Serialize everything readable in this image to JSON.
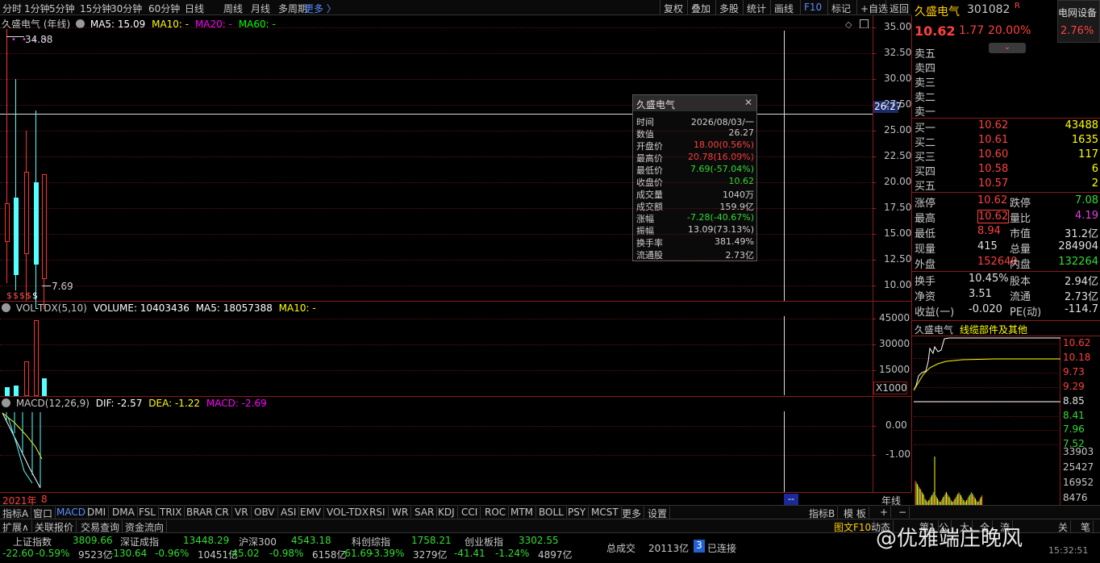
{
  "period_tabs": [
    "分时",
    "1分钟",
    "5分钟",
    "15分钟",
    "30分钟",
    "60分钟",
    "日线",
    "周线",
    "月线",
    "多周期",
    "更多 〉"
  ],
  "right_buttons": [
    "复权",
    "叠加",
    "多股",
    "统计",
    "画线",
    "F10",
    "标记",
    "+自选",
    "返回"
  ],
  "kline": {
    "stock_name_period": "久盛电气 (年线)",
    "ma5": "MA5: 15.09",
    "ma10": "MA10: -",
    "ma20": "MA20: -",
    "ma60": "MA60: -",
    "high_label": "34.88",
    "low_label": "7.69",
    "price_axis": [
      "35.00",
      "32.50",
      "30.00",
      "27.50",
      "25.00",
      "22.50",
      "20.00",
      "17.50",
      "15.00",
      "12.50",
      "10.00"
    ],
    "cursor_price": "26.27",
    "candles": [
      {
        "open": 14.2,
        "close": 18.0,
        "high": 34.88,
        "low": 10.2
      },
      {
        "open": 18.5,
        "close": 11.0,
        "high": 30.0,
        "low": 9.5
      },
      {
        "open": 13.0,
        "close": 21.0,
        "high": 25.0,
        "low": 8.5
      },
      {
        "open": 20.0,
        "close": 12.0,
        "high": 27.0,
        "low": 7.69
      },
      {
        "open": 10.62,
        "close": 20.78,
        "high": 20.78,
        "low": 7.69
      }
    ]
  },
  "tooltip": {
    "title": "久盛电气",
    "close_icon": "close-icon",
    "rows": [
      {
        "k": "时间",
        "v": "2026/08/03/一",
        "c": "#d0d0d0"
      },
      {
        "k": "数值",
        "v": "26.27",
        "c": "#d0d0d0"
      },
      {
        "k": "开盘价",
        "v": "18.00(0.56%)",
        "c": "#ff4040"
      },
      {
        "k": "最高价",
        "v": "20.78(16.09%)",
        "c": "#ff4040"
      },
      {
        "k": "最低价",
        "v": "7.69(-57.04%)",
        "c": "#33dd33"
      },
      {
        "k": "收盘价",
        "v": "10.62",
        "c": "#33dd33"
      },
      {
        "k": "成交量",
        "v": "1040万",
        "c": "#d0d0d0"
      },
      {
        "k": "成交额",
        "v": "159.9亿",
        "c": "#d0d0d0"
      },
      {
        "k": "涨幅",
        "v": "-7.28(-40.67%)",
        "c": "#33dd33"
      },
      {
        "k": "振幅",
        "v": "13.09(73.13%)",
        "c": "#d0d0d0"
      },
      {
        "k": "换手率",
        "v": "381.49%",
        "c": "#d0d0d0"
      },
      {
        "k": "流通股",
        "v": "2.73亿",
        "c": "#d0d0d0"
      }
    ]
  },
  "volume": {
    "legend_name": "VOL-TDX(5,10)",
    "legend_volume": "VOLUME: 10403436",
    "legend_ma5": "MA5: 18057388",
    "legend_ma10": "MA10: -",
    "axis": [
      "45000",
      "30000",
      "15000"
    ],
    "unit": "X1000",
    "bars": [
      {
        "v": 5000,
        "up": false
      },
      {
        "v": 6000,
        "up": false
      },
      {
        "v": 20000,
        "up": true
      },
      {
        "v": 44000,
        "up": true
      },
      {
        "v": 10400,
        "up": false
      }
    ]
  },
  "macd": {
    "legend_name": "MACD(12,26,9)",
    "dif": "DIF: -2.57",
    "dea": "DEA: -1.22",
    "macd": "MACD: -2.69",
    "axis": [
      "0.00",
      "-1.00"
    ]
  },
  "x_axis": {
    "year_label": "2021年",
    "month_label": "8",
    "cursor_label": "--",
    "period_label": "年线"
  },
  "indicator_tabs": [
    "指标A",
    "窗口",
    "MACD",
    "DMI",
    "DMA",
    "FSL",
    "TRIX",
    "BRAR",
    "CR",
    "VR",
    "OBV",
    "ASI",
    "EMV",
    "VOL-TDX",
    "RSI",
    "WR",
    "SAR",
    "KDJ",
    "CCI",
    "ROC",
    "MTM",
    "BOLL",
    "PSY",
    "MCST",
    "更多",
    "设置"
  ],
  "indicator_right": [
    "指标B",
    "模 板",
    "+",
    "−"
  ],
  "function_tabs": [
    "扩展∧",
    "关联报价",
    "交易查询",
    "资金流向"
  ],
  "function_right": [
    "图文F10",
    "动态",
    "第1",
    "公",
    "大",
    "全",
    "流",
    "关",
    "笔"
  ],
  "indices": [
    {
      "name": "上证指数",
      "value": "3809.66",
      "chg": "-22.60",
      "pct": "-0.59%",
      "amt": "9523亿"
    },
    {
      "name": "深证成指",
      "value": "13448.29",
      "chg": "-130.64",
      "pct": "-0.96%",
      "amt": "10451亿"
    },
    {
      "name": "沪深300",
      "value": "4543.18",
      "chg": "-45.02",
      "pct": "-0.98%",
      "amt": "6158亿"
    },
    {
      "name": "科创综指",
      "value": "1758.21",
      "chg": "-61.69",
      "pct": "-3.39%",
      "amt": "3279亿"
    },
    {
      "name": "创业板指",
      "value": "3302.55",
      "chg": "-41.41",
      "pct": "-1.24%",
      "amt": "4897亿"
    }
  ],
  "total_turnover_label": "总成交",
  "total_turnover": "20113亿",
  "connection_badge": "3",
  "connection_status": "已连接",
  "watermark": "@优雅端庄晚风",
  "clock": "15:32:51",
  "quote": {
    "name": "久盛电气",
    "code": "301082",
    "flag": "R",
    "price": "10.62",
    "change": "1.77",
    "pct": "20.00%",
    "sector": "电网设备",
    "sector_pct": "2.76%",
    "sell": [
      {
        "label": "卖五"
      },
      {
        "label": "卖四"
      },
      {
        "label": "卖三"
      },
      {
        "label": "卖二"
      },
      {
        "label": "卖一"
      }
    ],
    "buy": [
      {
        "label": "买一",
        "price": "10.62",
        "vol": "43488"
      },
      {
        "label": "买二",
        "price": "10.61",
        "vol": "1635"
      },
      {
        "label": "买三",
        "price": "10.60",
        "vol": "117"
      },
      {
        "label": "买四",
        "price": "10.58",
        "vol": "6"
      },
      {
        "label": "买五",
        "price": "10.57",
        "vol": "2"
      }
    ],
    "stats": [
      {
        "k1": "涨停",
        "v1": "10.62",
        "c1": "#ff4040",
        "k2": "跌停",
        "v2": "7.08",
        "c2": "#33dd33"
      },
      {
        "k1": "最高",
        "v1": "10.62",
        "c1": "#ff4040",
        "k2": "量比",
        "v2": "4.19",
        "c2": "#e040e0"
      },
      {
        "k1": "最低",
        "v1": "8.94",
        "c1": "#ff4040",
        "k2": "市值",
        "v2": "31.2亿",
        "c2": "#e0e0e0"
      },
      {
        "k1": "现量",
        "v1": "415",
        "c1": "#e0e0e0",
        "k2": "总量",
        "v2": "284904",
        "c2": "#e0e0e0"
      },
      {
        "k1": "外盘",
        "v1": "152640",
        "c1": "#ff4040",
        "k2": "内盘",
        "v2": "132264",
        "c2": "#33dd33"
      }
    ],
    "fin": [
      {
        "k1": "换手",
        "v1": "10.45%",
        "k2": "股本",
        "v2": "2.94亿"
      },
      {
        "k1": "净资",
        "v1": "3.51",
        "k2": "流通",
        "v2": "2.73亿"
      },
      {
        "k1": "收益(一)",
        "v1": "-0.020",
        "k2": "PE(动)",
        "v2": "-114.7"
      }
    ]
  },
  "mini": {
    "name": "久盛电气",
    "tab": "线缆部件及其他",
    "price_axis": [
      "10.62",
      "10.18",
      "9.73",
      "9.29",
      "8.85",
      "8.41",
      "7.96",
      "7.52"
    ],
    "vol_axis": [
      "33903",
      "25427",
      "16952",
      "8476"
    ]
  },
  "colors": {
    "up": "#ff3232",
    "down": "#54ffff",
    "ma5": "#ffffff",
    "ma10": "#ffff00",
    "ma20": "#ff00ff",
    "ma60": "#00ff00",
    "grid": "#5a1212",
    "border": "#8b1a1a"
  }
}
